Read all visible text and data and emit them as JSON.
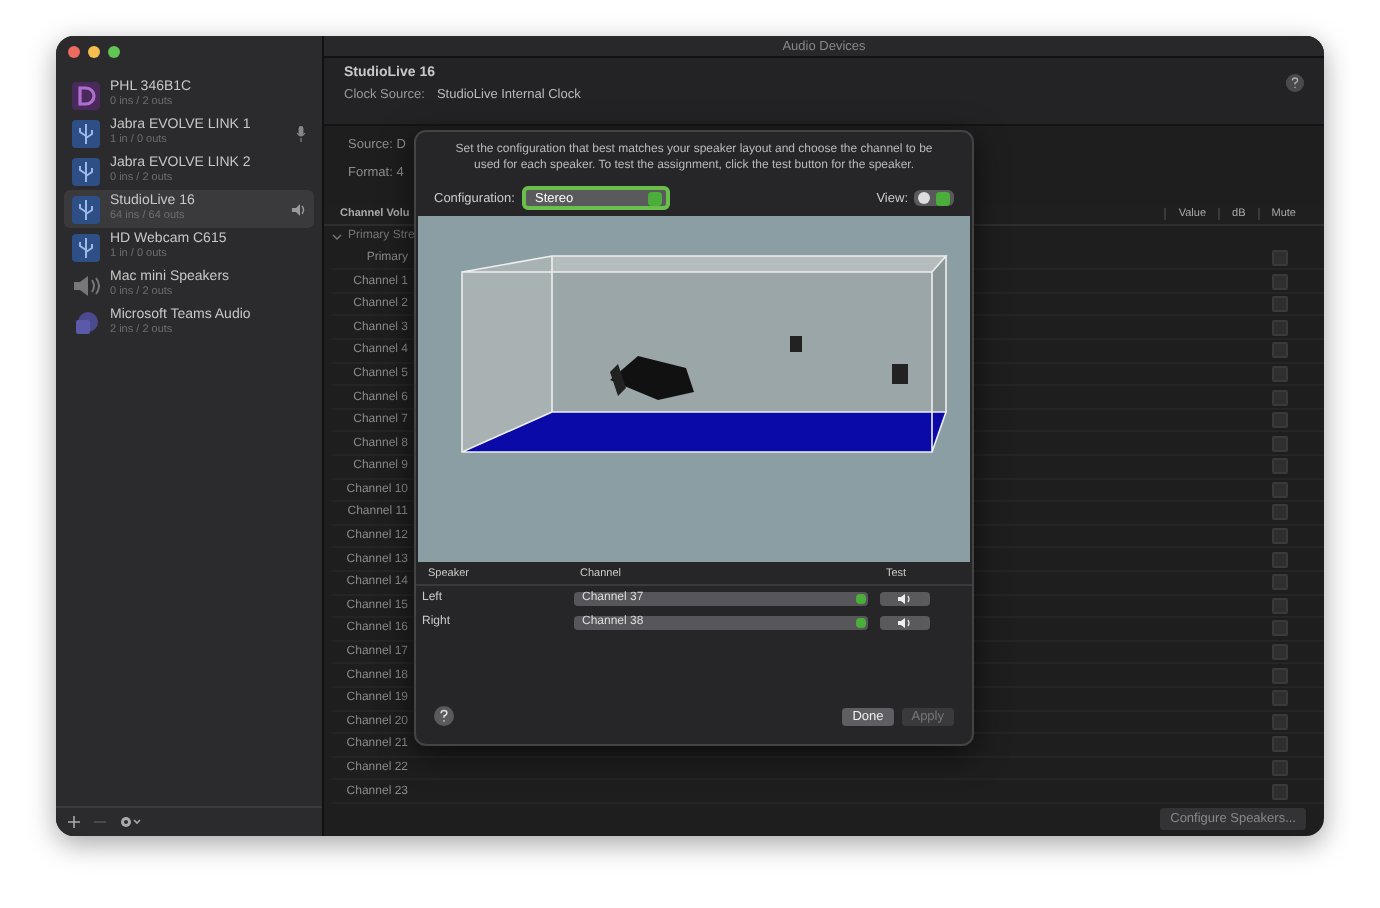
{
  "window": {
    "title": "Audio Devices"
  },
  "devices": [
    {
      "name": "PHL 346B1C",
      "io": "0 ins / 2 outs",
      "kind": "display",
      "selected": false,
      "default_input": false,
      "default_output": false
    },
    {
      "name": "Jabra EVOLVE LINK 1",
      "io": "1 in / 0 outs",
      "kind": "usb",
      "selected": false,
      "default_input": true,
      "default_output": false
    },
    {
      "name": "Jabra EVOLVE LINK 2",
      "io": "0 ins / 2 outs",
      "kind": "usb",
      "selected": false,
      "default_input": false,
      "default_output": false
    },
    {
      "name": "StudioLive 16",
      "io": "64 ins / 64 outs",
      "kind": "usb",
      "selected": true,
      "default_input": false,
      "default_output": true
    },
    {
      "name": "HD Webcam C615",
      "io": "1 in / 0 outs",
      "kind": "usb",
      "selected": false,
      "default_input": false,
      "default_output": false
    },
    {
      "name": "Mac mini Speakers",
      "io": "0 ins / 2 outs",
      "kind": "speaker",
      "selected": false,
      "default_input": false,
      "default_output": false
    },
    {
      "name": "Microsoft Teams Audio",
      "io": "2 ins / 2 outs",
      "kind": "teams",
      "selected": false,
      "default_input": false,
      "default_output": false
    }
  ],
  "header": {
    "device": "StudioLive 16",
    "clock_label": "Clock Source:",
    "clock_value": "StudioLive Internal Clock"
  },
  "source_label": "Source: D",
  "format_label": "Format: 4",
  "table": {
    "columns": [
      "Channel Volu",
      "Value",
      "dB",
      "Mute"
    ],
    "group": "Primary Stre",
    "expanded": true,
    "rows": [
      {
        "name": "Primary",
        "muted": false
      },
      {
        "name": "Channel 1",
        "muted": false
      },
      {
        "name": "Channel 2",
        "muted": false
      },
      {
        "name": "Channel 3",
        "muted": false
      },
      {
        "name": "Channel 4",
        "muted": false
      },
      {
        "name": "Channel 5",
        "muted": false
      },
      {
        "name": "Channel 6",
        "muted": false
      },
      {
        "name": "Channel 7",
        "muted": false
      },
      {
        "name": "Channel 8",
        "muted": false
      },
      {
        "name": "Channel 9",
        "muted": false
      },
      {
        "name": "Channel 10",
        "muted": false
      },
      {
        "name": "Channel 11",
        "muted": false
      },
      {
        "name": "Channel 12",
        "muted": false
      },
      {
        "name": "Channel 13",
        "muted": false
      },
      {
        "name": "Channel 14",
        "muted": false
      },
      {
        "name": "Channel 15",
        "muted": false
      },
      {
        "name": "Channel 16",
        "muted": false
      },
      {
        "name": "Channel 17",
        "muted": false
      },
      {
        "name": "Channel 18",
        "muted": false
      },
      {
        "name": "Channel 19",
        "muted": false
      },
      {
        "name": "Channel 20",
        "muted": false
      },
      {
        "name": "Channel 21",
        "muted": false
      },
      {
        "name": "Channel 22",
        "muted": false
      },
      {
        "name": "Channel 23",
        "muted": false
      }
    ]
  },
  "configure_button": "Configure Speakers...",
  "dialog": {
    "instructions": "Set the configuration that best matches your speaker layout and choose the channel to be used for each speaker. To test the assignment, click the test button for the speaker.",
    "configuration_label": "Configuration:",
    "configuration_value": "Stereo",
    "view_label": "View:",
    "columns": [
      "Speaker",
      "Channel",
      "Test"
    ],
    "speakers": [
      {
        "speaker": "Left",
        "channel": "Channel 37"
      },
      {
        "speaker": "Right",
        "channel": "Channel 38"
      }
    ],
    "buttons": [
      {
        "label": "Done",
        "disabled": false
      },
      {
        "label": "Apply",
        "disabled": true
      }
    ]
  }
}
